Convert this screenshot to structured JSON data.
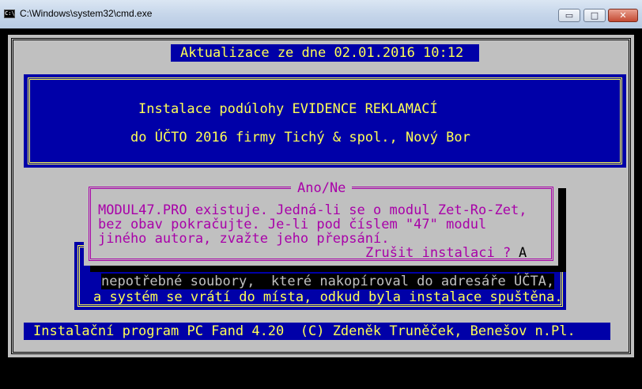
{
  "window": {
    "title": "C:\\Windows\\system32\\cmd.exe",
    "minimize_label": "▭",
    "maximize_label": "□",
    "close_label": "✕"
  },
  "header": {
    "date_line": "Aktualizace ze dne 02.01.2016 10:12",
    "line1": "Instalace podúlohy EVIDENCE REKLAMACÍ",
    "line2": "do ÚČTO 2016 firmy Tichý & spol., Nový Bor"
  },
  "dialog": {
    "caption": "Ano/Ne",
    "message_lines": [
      "MODUL47.PRO existuje. Jedná-li se o modul Zet-Ro-Zet,",
      "bez obav pokračujte. Je-li pod číslem \"47\" modul",
      "jiného autora, zvažte jeho přepsání."
    ],
    "question": "Zrušit instalaci ?",
    "answer": "A"
  },
  "info": {
    "line1": "nepotřebné soubory,  které nakopíroval do adresáře ÚČTA,",
    "line2": "a systém se vrátí do místa, odkud byla instalace spuštěna."
  },
  "status": {
    "text": "Instalační program PC Fand 4.20  (C) Zdeněk Truněček, Benešov n.Pl."
  },
  "colors": {
    "blue": "#0000a8",
    "yellow": "#ffff55",
    "magenta": "#a800a8",
    "grey": "#c0c0c0"
  }
}
